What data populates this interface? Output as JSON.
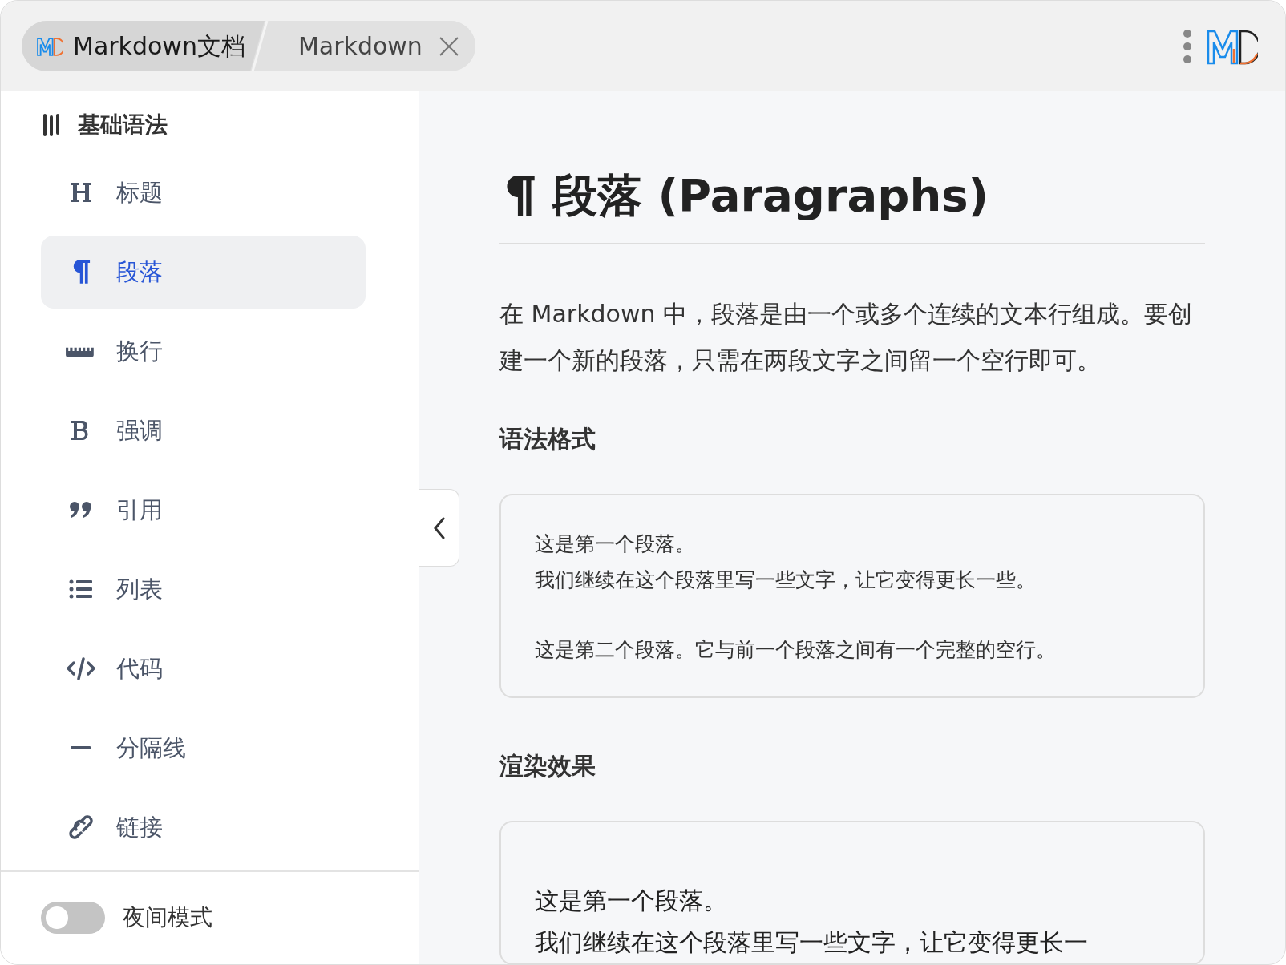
{
  "tabs": [
    {
      "label": "Markdown文档",
      "selected": true,
      "closable": false
    },
    {
      "label": "Markdown",
      "selected": false,
      "closable": true
    }
  ],
  "sidebar": {
    "heading": "基础语法",
    "items": [
      {
        "label": "标题",
        "selected": false
      },
      {
        "label": "段落",
        "selected": true
      },
      {
        "label": "换行",
        "selected": false
      },
      {
        "label": "强调",
        "selected": false
      },
      {
        "label": "引用",
        "selected": false
      },
      {
        "label": "列表",
        "selected": false
      },
      {
        "label": "代码",
        "selected": false
      },
      {
        "label": "分隔线",
        "selected": false
      },
      {
        "label": "链接",
        "selected": false
      }
    ]
  },
  "night_mode": {
    "label": "夜间模式",
    "on": false
  },
  "content": {
    "title": "段落 (Paragraphs)",
    "intro": "在 Markdown 中，段落是由一个或多个连续的文本行组成。要创建一个新的段落，只需在两段文字之间留一个空行即可。",
    "sections": [
      {
        "heading": "语法格式",
        "kind": "code",
        "paragraphs": [
          [
            "这是第一个段落。",
            "我们继续在这个段落里写一些文字，让它变得更长一些。"
          ],
          [
            "这是第二个段落。它与前一个段落之间有一个完整的空行。"
          ]
        ]
      },
      {
        "heading": "渲染效果",
        "kind": "rendered",
        "paragraphs": [
          [
            "这是第一个段落。",
            "我们继续在这个段落里写一些文字，让它变得更长一"
          ]
        ]
      }
    ]
  }
}
